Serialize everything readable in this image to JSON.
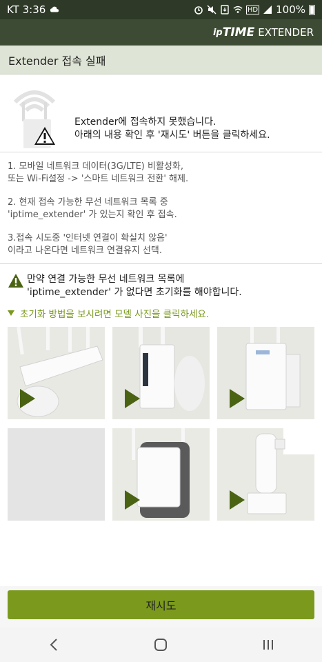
{
  "status_bar": {
    "carrier_time": "KT 3:36",
    "battery": "100%",
    "signal_label": "HD"
  },
  "header": {
    "brand_ip": "ip",
    "brand_time": "TIME",
    "brand_extender": "EXTENDER"
  },
  "title": "Extender 접속 실패",
  "notice": {
    "line1": "Extender에 접속하지 못했습니다.",
    "line2": "아래의 내용 확인 후 '재시도' 버튼을 클릭하세요."
  },
  "instructions": [
    "1. 모바일 네트워크 데이터(3G/LTE) 비활성화,\n 또는 Wi-Fi설정 -> '스마트 네트워크 전환' 해제.",
    "2. 현재 접속 가능한 무선 네트워크 목록 중\n 'iptime_extender' 가 있는지 확인 후 접속.",
    "3.접속 시도중 '인터넷 연결이 확실치 않음'\n 이라고 나온다면 네트워크 연결유지 선택."
  ],
  "warning": "만약 연결 가능한 무선 네트워크 목록에\n'iptime_extender' 가 없다면 초기화를 해야합니다.",
  "hint": "초기화 방법을 보시려면 모델 사진을 클릭하세요.",
  "retry_label": "재시도",
  "colors": {
    "accent_green": "#7b9a1d",
    "header_dark": "#3e4b34",
    "title_bg": "#dfe5d6"
  }
}
